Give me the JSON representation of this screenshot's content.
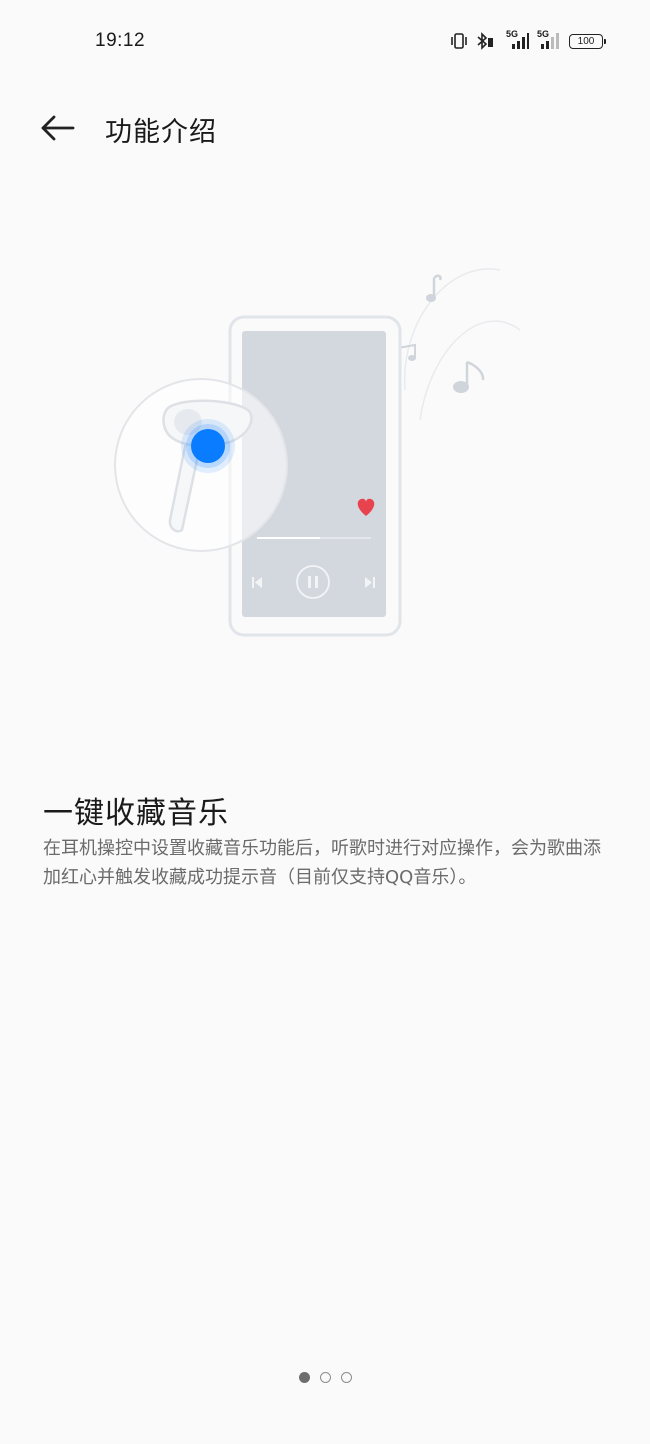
{
  "status_bar": {
    "time": "19:12",
    "battery_level": "100",
    "network_labels": [
      "5G",
      "5G"
    ],
    "icons": [
      "vibrate-icon",
      "bluetooth-icon",
      "signal-5g-icon",
      "signal-5g-icon",
      "battery-icon"
    ]
  },
  "header": {
    "back_icon": "arrow-left-icon",
    "title": "功能介绍"
  },
  "illustration": {
    "icons": [
      "phone-icon",
      "earbud-icon",
      "heart-icon",
      "pause-icon",
      "previous-icon",
      "next-icon",
      "music-note-icon"
    ],
    "colors": {
      "tap_dot": "#0a7cff",
      "heart": "#e8424e",
      "screen": "#d3d8df"
    }
  },
  "feature": {
    "title": "一键收藏音乐",
    "description": "在耳机操控中设置收藏音乐功能后，听歌时进行对应操作，会为歌曲添加红心并触发收藏成功提示音（目前仅支持QQ音乐）。"
  },
  "pager": {
    "total": 3,
    "current": 1
  }
}
